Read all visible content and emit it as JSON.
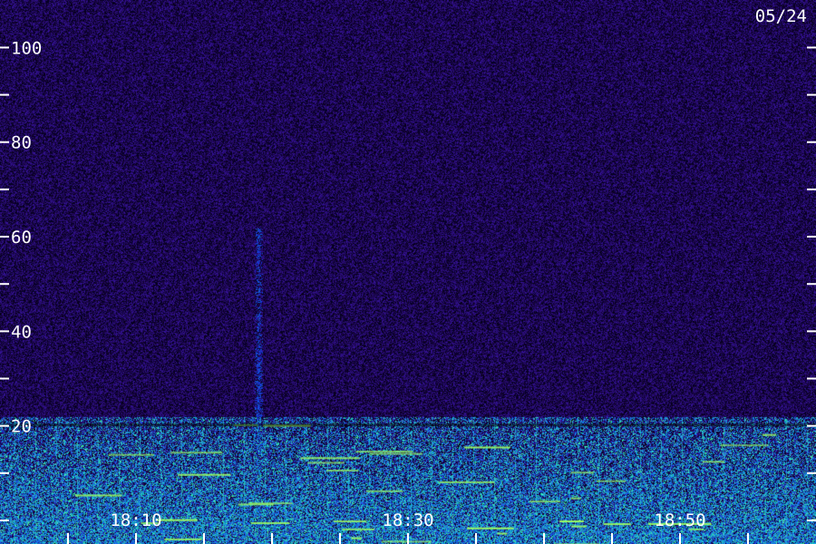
{
  "chart_data": {
    "type": "heatmap",
    "title": "",
    "xlabel": "",
    "ylabel": "",
    "date_label": "05/24",
    "y_axis": {
      "range": [
        0,
        102
      ],
      "major_ticks": [
        20,
        40,
        60,
        80,
        100
      ],
      "minor_ticks": [
        0,
        10,
        30,
        50,
        70,
        90
      ],
      "tick_labels": [
        "20",
        "40",
        "60",
        "80",
        "100"
      ]
    },
    "x_axis": {
      "range": [
        "18:00",
        "19:00"
      ],
      "tick_labels": [
        {
          "value": "18:10",
          "text": "18:10"
        },
        {
          "value": "18:30",
          "text": "18:30"
        },
        {
          "value": "18:50",
          "text": "18:50"
        }
      ],
      "minor_ticks": [
        "18:05",
        "18:10",
        "18:15",
        "18:20",
        "18:25",
        "18:30",
        "18:35",
        "18:40",
        "18:45",
        "18:50",
        "18:55"
      ]
    },
    "colors": {
      "background_noise": "#2a137a",
      "low_band": "#2040c8",
      "strong_signal": "#30e0a0",
      "peak": "#a0ff60"
    },
    "features": {
      "noise_floor_band": [
        0,
        22
      ],
      "vertical_streak_time": "18:19",
      "vertical_streak_range": [
        14,
        62
      ]
    }
  }
}
